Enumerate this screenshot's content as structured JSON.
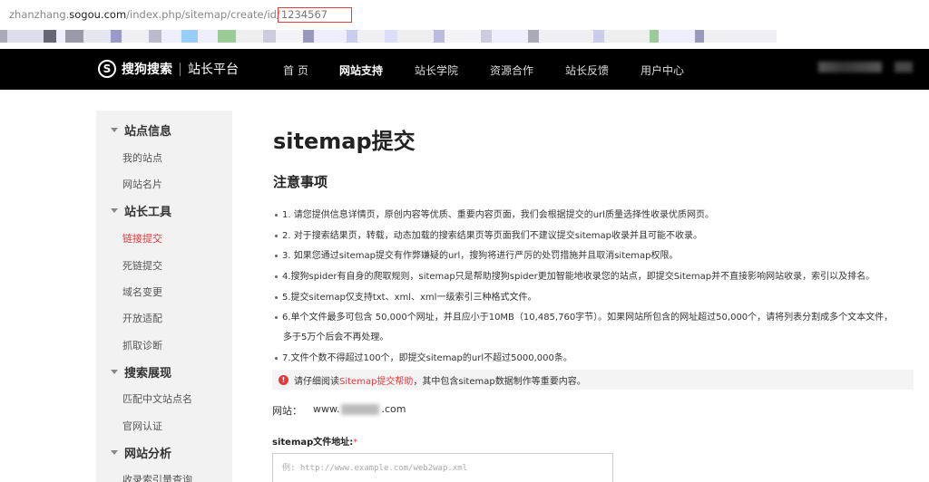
{
  "url": {
    "prefix": "zhanzhang.",
    "host": "sogou.com",
    "path": "/index.php/sitemap/create/id/",
    "id": "1234567"
  },
  "nav": {
    "logo_text": "搜狗搜索",
    "logo_sub": "站长平台",
    "items": [
      "首 页",
      "网站支持",
      "站长学院",
      "资源合作",
      "站长反馈",
      "用户中心"
    ],
    "active": "网站支持"
  },
  "sidebar": {
    "sections": [
      {
        "title": "站点信息",
        "items": [
          "我的站点",
          "网站名片"
        ]
      },
      {
        "title": "站长工具",
        "items": [
          "链接提交",
          "死链提交",
          "域名变更",
          "开放适配",
          "抓取诊断"
        ]
      },
      {
        "title": "搜索展现",
        "items": [
          "匹配中文站点名",
          "官网认证"
        ]
      },
      {
        "title": "网站分析",
        "items": [
          "收录索引量查询"
        ]
      }
    ],
    "active_item": "链接提交"
  },
  "main": {
    "title": "sitemap提交",
    "subtitle": "注意事项",
    "notes": [
      "1. 请您提供信息详情页，原创内容等优质、重要内容页面，我们会根据提交的url质量选择性收录优质网页。",
      "2. 对于搜索结果页，转载，动态加载的搜索结果页等页面我们不建议提交sitemap收录并且可能不收录。",
      "3. 如果您通过sitemap提交有作弊嫌疑的url，搜狗将进行严厉的处罚措施并且取消sitemap权限。",
      "4.搜狗spider有自身的爬取规则，sitemap只是帮助搜狗spider更加智能地收录您的站点，即提交Sitemap并不直接影响网站收录，索引以及排名。",
      "5.提交sitemap仅支持txt、xml、xml一级索引三种格式文件。",
      "6.单个文件最多可包含 50,000个网址，并且应小于10MB（10,485,760字节）。如果网站所包含的网址超过50,000个，请将列表分割成多个文本文件，",
      "多于5万个后会不再处理。",
      "7.文件个数不得超过100个，即提交sitemap的url不超过5000,000条。"
    ],
    "warn_prefix": "请仔细阅读",
    "warn_link": "Sitemap提交帮助",
    "warn_suffix": "，其中包含sitemap数据制作等重要内容。",
    "site_label": "网站：",
    "site_prefix": "www.",
    "site_suffix": ".com",
    "field_label": "sitemap文件地址:",
    "field_required": "*",
    "input_placeholder": "例: http://www.example.com/web2wap.xml"
  }
}
